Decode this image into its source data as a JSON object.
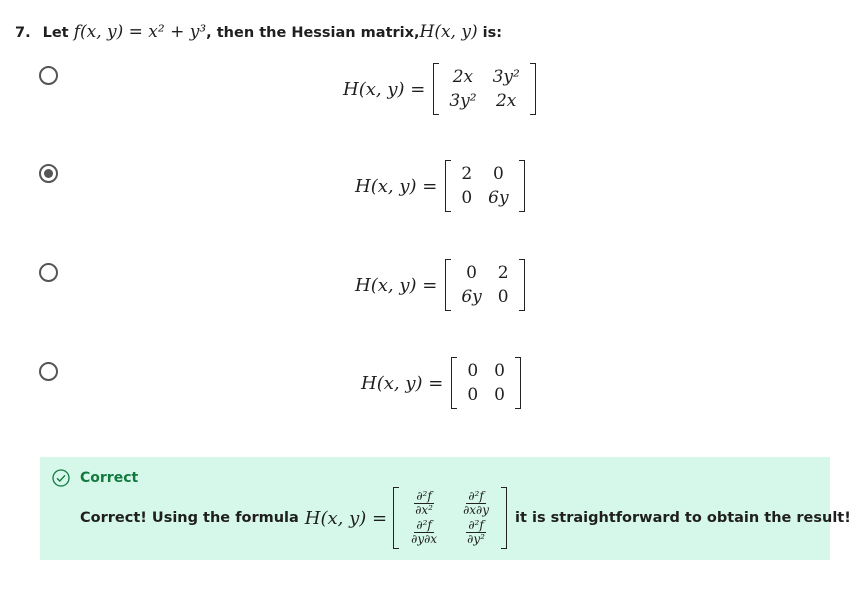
{
  "question": {
    "number": "7.",
    "prefix": "Let",
    "function": "f(x, y) = x² + y³",
    "middle": ", then the Hessian matrix,",
    "hessian": "H(x, y)",
    "suffix": "is:"
  },
  "options": [
    {
      "lhs": "H(x, y) =",
      "matrix": [
        "2x",
        "3y²",
        "3y²",
        "2x"
      ],
      "selected": false
    },
    {
      "lhs": "H(x, y) =",
      "matrix": [
        "2",
        "0",
        "0",
        "6y"
      ],
      "selected": true
    },
    {
      "lhs": "H(x, y) =",
      "matrix": [
        "0",
        "2",
        "6y",
        "0"
      ],
      "selected": false
    },
    {
      "lhs": "H(x, y) =",
      "matrix": [
        "0",
        "0",
        "0",
        "0"
      ],
      "selected": false
    }
  ],
  "feedback": {
    "status": "Correct",
    "text_before": "Correct! Using the formula",
    "formula_lhs": "H(x, y) =",
    "text_after": "it is straightforward to obtain the result!",
    "matrix": [
      {
        "num": "∂²f",
        "den": "∂x²"
      },
      {
        "num": "∂²f",
        "den": "∂x∂y"
      },
      {
        "num": "∂²f",
        "den": "∂y∂x"
      },
      {
        "num": "∂²f",
        "den": "∂y²"
      }
    ],
    "accent": "#137a3f",
    "background": "#d6f8ea"
  }
}
